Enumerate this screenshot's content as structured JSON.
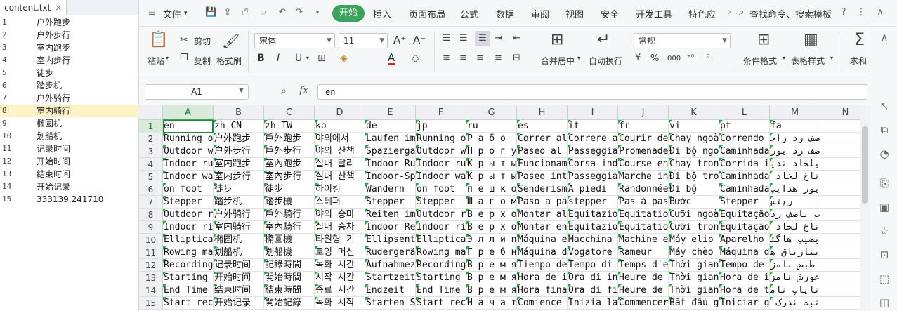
{
  "editor": {
    "tab_title": "content.txt",
    "close_glyph": "×",
    "lines": [
      {
        "n": "1",
        "text": "户外跑步"
      },
      {
        "n": "2",
        "text": "户外步行"
      },
      {
        "n": "3",
        "text": "室内跑步"
      },
      {
        "n": "4",
        "text": "室内步行"
      },
      {
        "n": "5",
        "text": "徒步"
      },
      {
        "n": "6",
        "text": "踏步机"
      },
      {
        "n": "7",
        "text": "户外骑行"
      },
      {
        "n": "8",
        "text": "室内骑行"
      },
      {
        "n": "9",
        "text": "椭圆机"
      },
      {
        "n": "10",
        "text": "划船机"
      },
      {
        "n": "11",
        "text": "记录时间"
      },
      {
        "n": "12",
        "text": "开始时间"
      },
      {
        "n": "13",
        "text": "结束时间"
      },
      {
        "n": "14",
        "text": "开始记录"
      },
      {
        "n": "15",
        "text": "333139.241710"
      }
    ]
  },
  "menubar": {
    "file": "文件",
    "tabs": [
      "开始",
      "插入",
      "页面布局",
      "公式",
      "数据",
      "审阅",
      "视图",
      "安全",
      "开发工具",
      "特色应"
    ],
    "active_tab": "开始",
    "search": "查找命令、搜索模板",
    "accent": "#3aa25a"
  },
  "ribbon": {
    "paste": "粘贴",
    "cut": "剪切",
    "copy": "复制",
    "format_painter": "格式刷",
    "font_name": "宋体",
    "font_size": "11",
    "merge_center": "合并居中",
    "wrap_text": "自动换行",
    "number_format": "常规",
    "conditional_format": "条件格式",
    "table_style": "表格样式",
    "sum": "求和",
    "percent": "%",
    "thousands": "000",
    "bold": "B",
    "italic": "I",
    "underline": "U",
    "font_color_glyph": "A",
    "grow_font": "A⁺",
    "shrink_font": "A⁻"
  },
  "formula_bar": {
    "cell_ref": "A1",
    "fx": "fx",
    "value": "en"
  },
  "sheet": {
    "columns": [
      "A",
      "B",
      "C",
      "D",
      "E",
      "F",
      "G",
      "H",
      "I",
      "J",
      "K",
      "L",
      "M",
      "N"
    ],
    "selected_column": "A",
    "selected_row": "1",
    "rows": [
      {
        "n": "1",
        "cells": [
          "en",
          "zh-CN",
          "zh-TW",
          "ko",
          "de",
          "jp",
          "ru",
          "es",
          "it",
          "fr",
          "vi",
          "pt",
          "fa",
          ""
        ]
      },
      {
        "n": "2",
        "cells": [
          "Running o",
          "户外跑步",
          "戶外跑步",
          "야외에서",
          "Laufen im",
          "Running o",
          "Р а б о",
          "Correr al",
          "Correre a",
          "Courir de",
          "Chạy ngoà",
          "Correndo",
          "ضف رد راجا لاح رد",
          ""
        ]
      },
      {
        "n": "3",
        "cells": [
          "Outdoor w",
          "户外步行",
          "戶外步行",
          "야외 산책",
          "Spazierga",
          "Outdoor w",
          "П р о г у",
          "Paseo al",
          "Passeggia",
          "Promenade",
          "Đi bộ ngo",
          "Caminhada",
          "ضف رد یور هدایپ",
          ""
        ]
      },
      {
        "n": "4",
        "cells": [
          "Indoor ru",
          "室内跑步",
          "室內跑步",
          "실내 달리",
          "Indoor Ru",
          "Indoor ru",
          "К р ы т ы",
          "Funcionam",
          "Corsa ind",
          "Course en",
          "Chạy tron",
          "Corrida i",
          "یلخاد ندیود",
          ""
        ]
      },
      {
        "n": "5",
        "cells": [
          "Indoor wa",
          "室内步行",
          "室內步行",
          "실내 산책",
          "Indoor-Sp",
          "Indoor wa",
          "К р ы т ы",
          "Paseo int",
          "Passeggia",
          "Marche in",
          "Đi bộ tro",
          "Caminhada",
          "ناخ لخاد یور هدایپ",
          ""
        ]
      },
      {
        "n": "6",
        "cells": [
          "on foot",
          "徒步",
          "徒步",
          "하이킹",
          "Wandern",
          "on foot",
          "п е ш к о",
          "Senderism",
          "A piedi",
          "Randonnée",
          "Đi bộ",
          "Caminhada",
          "یور هدایپ",
          ""
        ]
      },
      {
        "n": "7",
        "cells": [
          "Stepper",
          "踏步机",
          "踏步機",
          "스테퍼",
          "Stepper",
          "Stepper",
          "Ш а г о м",
          "Paso a pa",
          "stepper",
          "Pas à pas",
          "Bước",
          "Stepper",
          "رپتس",
          ""
        ]
      },
      {
        "n": "8",
        "cells": [
          "Outdoor r",
          "户外骑行",
          "戶外騎行",
          "야외 승마",
          "Reiten im",
          "Outdoor r",
          "В е р х о",
          "Montar al",
          "Equitazio",
          "Équitatio",
          "Cưỡi ngoà",
          "Equitação",
          "ب یاضف رد یراوس",
          ""
        ]
      },
      {
        "n": "9",
        "cells": [
          "Indoor ri",
          "室内骑行",
          "室內騎行",
          "실내 승차",
          "Indoor Re",
          "Indoor ri",
          "В е р х о",
          "Montar en",
          "Equitazio",
          "Équitatio",
          "Cưỡi tron",
          "Equitação",
          "ناخ لخاد یراوس",
          ""
        ]
      },
      {
        "n": "10",
        "cells": [
          "Elliptica",
          "椭圆机",
          "橢圓機",
          "타원형 기",
          "Ellipsent",
          "Elliptica",
          "Э л л и п",
          "Máquina e",
          "Macchina",
          "Machine e",
          "Máy elip",
          "Aparelho",
          "یضیب هاگتسد",
          ""
        ]
      },
      {
        "n": "11",
        "cells": [
          "Rowing ma",
          "划船机",
          "划船機",
          "로잉 머신",
          "Rudergerä",
          "Rowing ma",
          "Г р е б н",
          "Máquina d",
          "Vogatore",
          "Rameur",
          "Máy chèo",
          "Máquina d",
          "یناریاق هاگتسد",
          ""
        ]
      },
      {
        "n": "12",
        "cells": [
          "Recording",
          "记录时间",
          "記錄時間",
          "녹화 시간",
          "Aufnahmez",
          "Recording",
          "В р е м я",
          "Tiempo de",
          "Tempo di",
          "Temps d'e",
          "Thời gian",
          "Tempo de",
          "طبض نامز",
          ""
        ]
      },
      {
        "n": "13",
        "cells": [
          "Starting",
          "开始时间",
          "開始時間",
          "시작 시간",
          "Startzeit",
          "Starting",
          "В р е м я",
          "Hora de i",
          "Ora di in",
          "Heure de",
          "Thời gian",
          "Hora de i",
          "عورش نامز",
          ""
        ]
      },
      {
        "n": "14",
        "cells": [
          "End Time",
          "结束时间",
          "結束時間",
          "종료 시간",
          "Endzeit",
          "End Time",
          "В р е м я",
          "Hora fina",
          "Ora di fi",
          "Heure de",
          "Thời gian",
          "Hora de t",
          "نایاپ نامز",
          ""
        ]
      },
      {
        "n": "15",
        "cells": [
          "Start rec",
          "开始记录",
          "開始記錄",
          "녹화 시작",
          "Starten S",
          "Start rec",
          "Н а ч а т",
          "Comience",
          "Inizia la",
          "Commencer",
          "Bắt đầu g",
          "Iniciar g",
          "تبث ندرک عورش",
          ""
        ]
      }
    ]
  }
}
